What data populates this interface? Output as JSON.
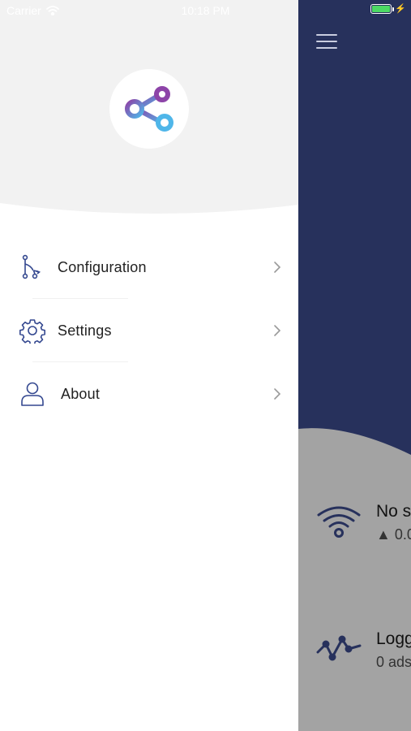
{
  "status_bar": {
    "carrier": "Carrier",
    "time": "10:18 PM"
  },
  "colors": {
    "drawer_header_bg": "#f2f2f2",
    "app_header_bg": "#27315c",
    "app_body_bg": "#a3a3a3",
    "icon_navy": "#33478f",
    "logo_gradient_start": "#8d44a8",
    "logo_gradient_end": "#4fb6e9"
  },
  "drawer": {
    "logo_icon": "share-nodes-icon",
    "menu": [
      {
        "label": "Configuration",
        "icon": "branch-nodes-icon"
      },
      {
        "label": "Settings",
        "icon": "gear-icon"
      },
      {
        "label": "About",
        "icon": "user-icon"
      }
    ]
  },
  "app": {
    "menu_icon": "hamburger-icon",
    "rows": [
      {
        "title": "No s",
        "subtitle": "▲ 0.0",
        "icon": "wifi-icon"
      },
      {
        "title": "Logg",
        "subtitle": "0 ads",
        "icon": "activity-icon"
      }
    ]
  }
}
